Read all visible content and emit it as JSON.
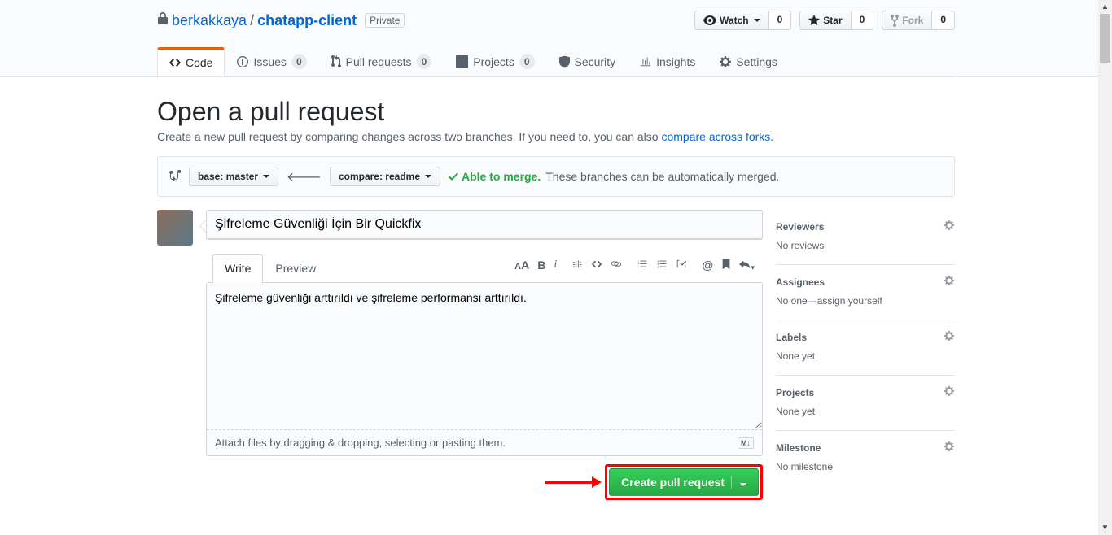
{
  "repo": {
    "owner": "berkakkaya",
    "name": "chatapp-client",
    "visibility": "Private"
  },
  "pageactions": {
    "watch": {
      "label": "Watch",
      "count": "0"
    },
    "star": {
      "label": "Star",
      "count": "0"
    },
    "fork": {
      "label": "Fork",
      "count": "0"
    }
  },
  "nav": {
    "code": "Code",
    "issues": {
      "label": "Issues",
      "count": "0"
    },
    "pulls": {
      "label": "Pull requests",
      "count": "0"
    },
    "projects": {
      "label": "Projects",
      "count": "0"
    },
    "security": "Security",
    "insights": "Insights",
    "settings": "Settings"
  },
  "page": {
    "title": "Open a pull request",
    "subtitle_pre": "Create a new pull request by comparing changes across two branches. If you need to, you can also ",
    "subtitle_link": "compare across forks",
    "subtitle_post": "."
  },
  "range": {
    "base_label": "base: master",
    "compare_label": "compare: readme",
    "merge_ok": "Able to merge.",
    "merge_desc": "These branches can be automatically merged."
  },
  "form": {
    "title_value": "Şifreleme Güvenliği İçin Bir Quickfix",
    "tab_write": "Write",
    "tab_preview": "Preview",
    "body_value": "Şifreleme güvenliği arttırıldı ve şifreleme performansı arttırıldı.",
    "attach_hint": "Attach files by dragging & dropping, selecting or pasting them.",
    "md_badge": "M↓",
    "submit": "Create pull request"
  },
  "sidebar": {
    "reviewers": {
      "title": "Reviewers",
      "body": "No reviews"
    },
    "assignees": {
      "title": "Assignees",
      "body_pre": "No one—",
      "body_link": "assign yourself"
    },
    "labels": {
      "title": "Labels",
      "body": "None yet"
    },
    "projects": {
      "title": "Projects",
      "body": "None yet"
    },
    "milestone": {
      "title": "Milestone",
      "body": "No milestone"
    }
  }
}
